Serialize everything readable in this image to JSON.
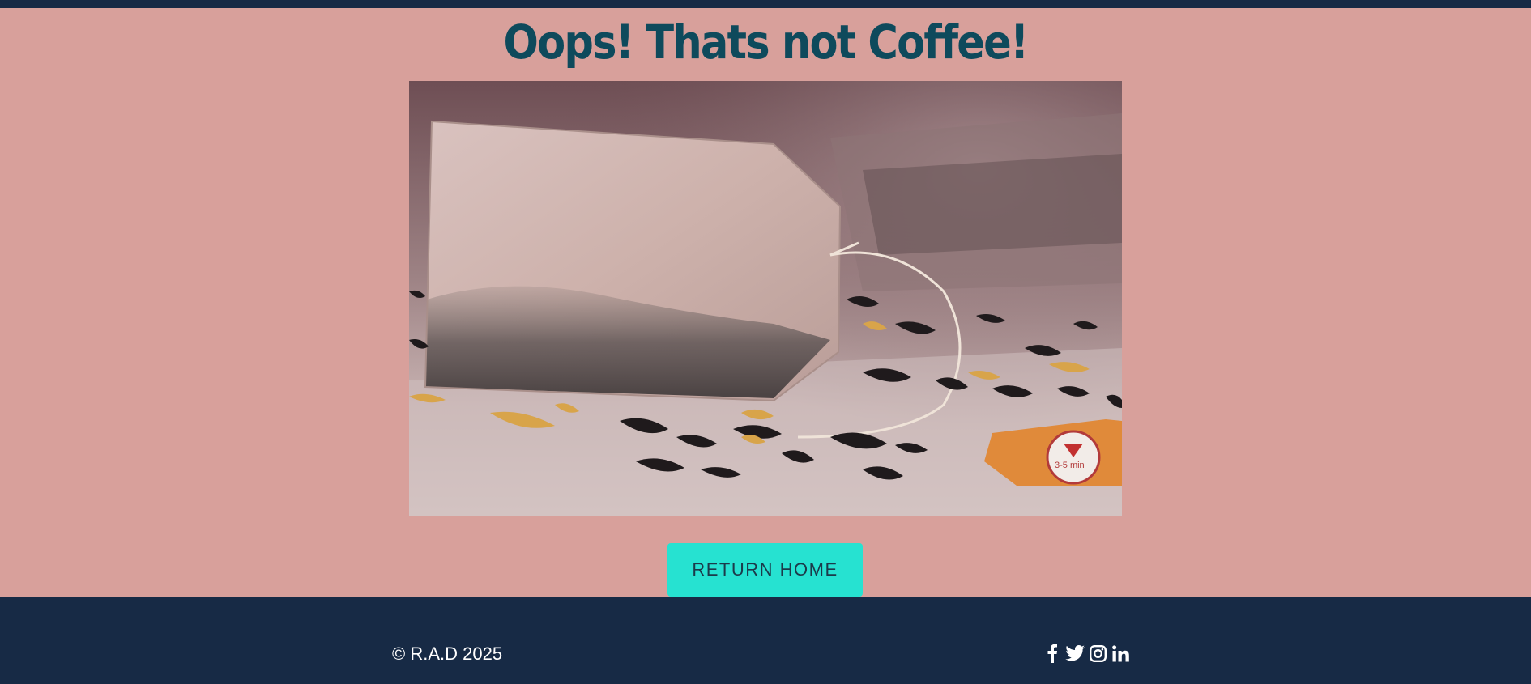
{
  "header": {
    "title": "Oops! Thats not Coffee!"
  },
  "hero": {
    "image_subject": "tea bag with loose tea leaves"
  },
  "actions": {
    "return_home_label": "RETURN HOME"
  },
  "footer": {
    "copyright": "© R.A.D 2025",
    "social": [
      {
        "icon": "facebook-icon"
      },
      {
        "icon": "twitter-icon"
      },
      {
        "icon": "instagram-icon"
      },
      {
        "icon": "linkedin-icon"
      }
    ]
  },
  "colors": {
    "background": "#d8a09b",
    "navy": "#172a45",
    "title": "#0e4a5c",
    "button": "#26e2d1"
  }
}
